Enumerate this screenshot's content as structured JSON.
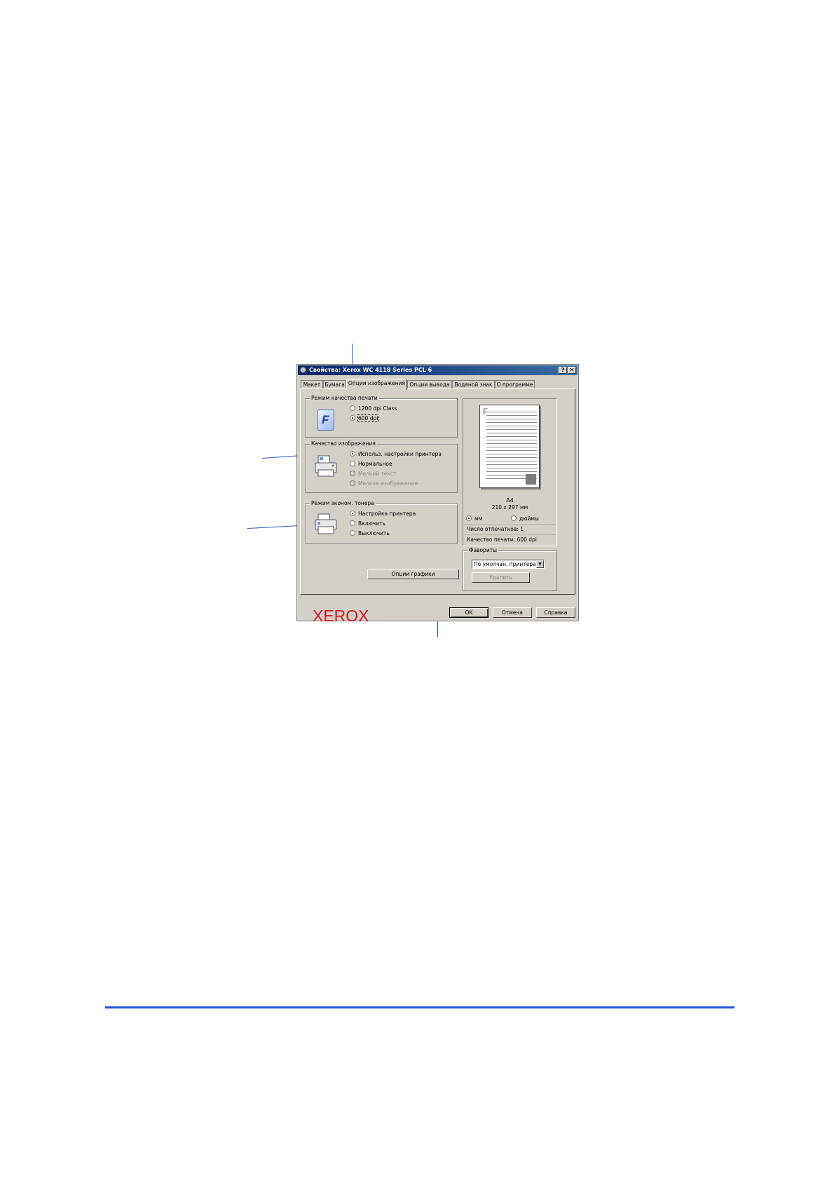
{
  "dialog": {
    "title": "Свойства: Xerox WC 4118 Series PCL 6",
    "help_label": "?",
    "close_label": "✕"
  },
  "tabs": [
    {
      "label": "Макет"
    },
    {
      "label": "Бумага"
    },
    {
      "label": "Опции изображения",
      "active": true
    },
    {
      "label": "Опции вывода"
    },
    {
      "label": "Водяной знак"
    },
    {
      "label": "О программе"
    }
  ],
  "print_quality_mode": {
    "legend": "Режим качества печати",
    "icon_letter": "F",
    "options": [
      {
        "label": "1200 dpi Class",
        "selected": false
      },
      {
        "label": "600 dpi",
        "selected": true
      }
    ]
  },
  "image_quality": {
    "legend": "Качество изображения",
    "options": [
      {
        "label": "Использ. настройки принтера",
        "selected": true,
        "enabled": true
      },
      {
        "label": "Нормальное",
        "selected": false,
        "enabled": true
      },
      {
        "label": "Мелкий текст",
        "selected": false,
        "enabled": false
      },
      {
        "label": "Мелкое изображение",
        "selected": false,
        "enabled": false
      }
    ]
  },
  "toner_save": {
    "legend": "Режим эконом. тонера",
    "options": [
      {
        "label": "Настройка принтера",
        "selected": true
      },
      {
        "label": "Включить",
        "selected": false
      },
      {
        "label": "Выключить",
        "selected": false
      }
    ]
  },
  "graphics_options_button": "Опции графики",
  "logo_text": "XEROX",
  "preview": {
    "page_letter": "F",
    "paper_size": "A4",
    "paper_dimensions": "210 x 297 мм",
    "units": [
      {
        "label": "мм",
        "selected": true
      },
      {
        "label": "дюймы",
        "selected": false
      }
    ],
    "copies_label": "Число отпечатков: 1",
    "quality_label": "Качество печати: 600 dpi"
  },
  "favorites": {
    "legend": "Фавориты",
    "selected": "По умолчан. принтера",
    "delete_label": "Удалить"
  },
  "footer": {
    "ok_label": "OK",
    "cancel_label": "Отмена",
    "help_label": "Справка"
  }
}
